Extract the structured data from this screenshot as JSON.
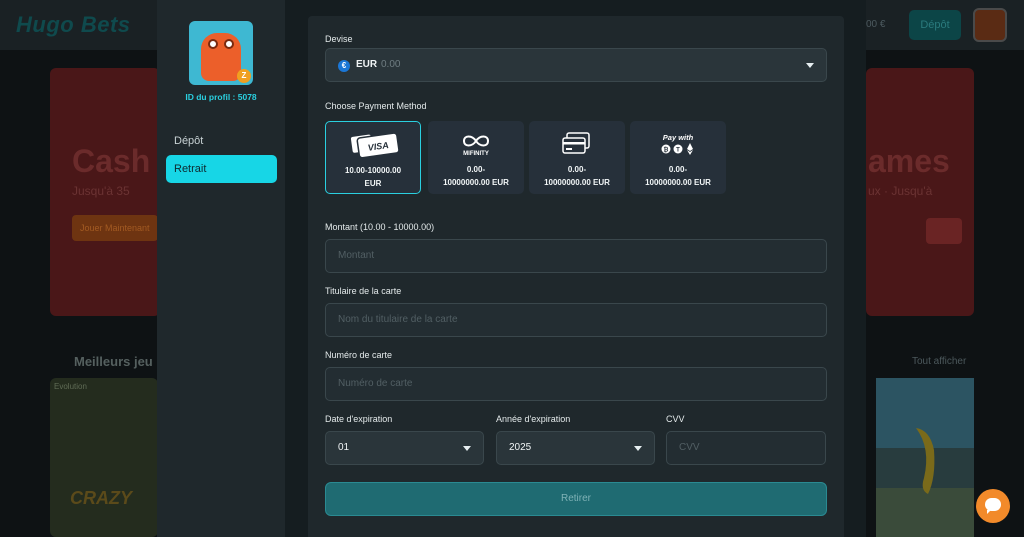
{
  "background": {
    "logo": "Hugo Bets",
    "balance": "00 €",
    "deposit_button": "Dépôt",
    "banner_left": {
      "title": "Cash",
      "subtitle": "Jusqu'à 35",
      "button": "Jouer Maintenant"
    },
    "banner_right": {
      "title": "ames",
      "subtitle": "ux · Jusqu'à"
    },
    "section_title": "Meilleurs jeu",
    "section_link": "Tout afficher",
    "card_left": {
      "tag": "Evolution",
      "title": "CRAZY"
    }
  },
  "sidebar": {
    "profile_id": "ID du profil : 5078",
    "items": [
      {
        "label": "Dépôt",
        "active": false
      },
      {
        "label": "Retrait",
        "active": true
      }
    ]
  },
  "form": {
    "currency_label": "Devise",
    "currency_code": "EUR",
    "currency_balance": "0.00",
    "payment_label": "Choose Payment Method",
    "methods": [
      {
        "icon": "visa-card-icon",
        "range_line1": "10.00-10000.00",
        "range_line2": "EUR",
        "selected": true
      },
      {
        "icon": "mifinity-icon",
        "name": "MIFINITY",
        "range_line1": "0.00-",
        "range_line2": "10000000.00 EUR",
        "selected": false
      },
      {
        "icon": "bank-card-icon",
        "range_line1": "0.00-",
        "range_line2": "10000000.00 EUR",
        "selected": false
      },
      {
        "icon": "pay-with-crypto-icon",
        "name": "Pay with",
        "range_line1": "0.00-",
        "range_line2": "10000000.00 EUR",
        "selected": false
      }
    ],
    "amount_label": "Montant (10.00 - 10000.00)",
    "amount_placeholder": "Montant",
    "holder_label": "Titulaire de la carte",
    "holder_placeholder": "Nom du titulaire de la carte",
    "card_number_label": "Numéro de carte",
    "card_number_placeholder": "Numéro de carte",
    "expiry_month_label": "Date d'expiration",
    "expiry_month_value": "01",
    "expiry_year_label": "Année d'expiration",
    "expiry_year_value": "2025",
    "cvv_label": "CVV",
    "cvv_placeholder": "CVV",
    "submit_label": "Retirer"
  },
  "colors": {
    "accent": "#17d6e6",
    "submit_bg": "#1f6b72",
    "chat": "#f28a2a"
  }
}
